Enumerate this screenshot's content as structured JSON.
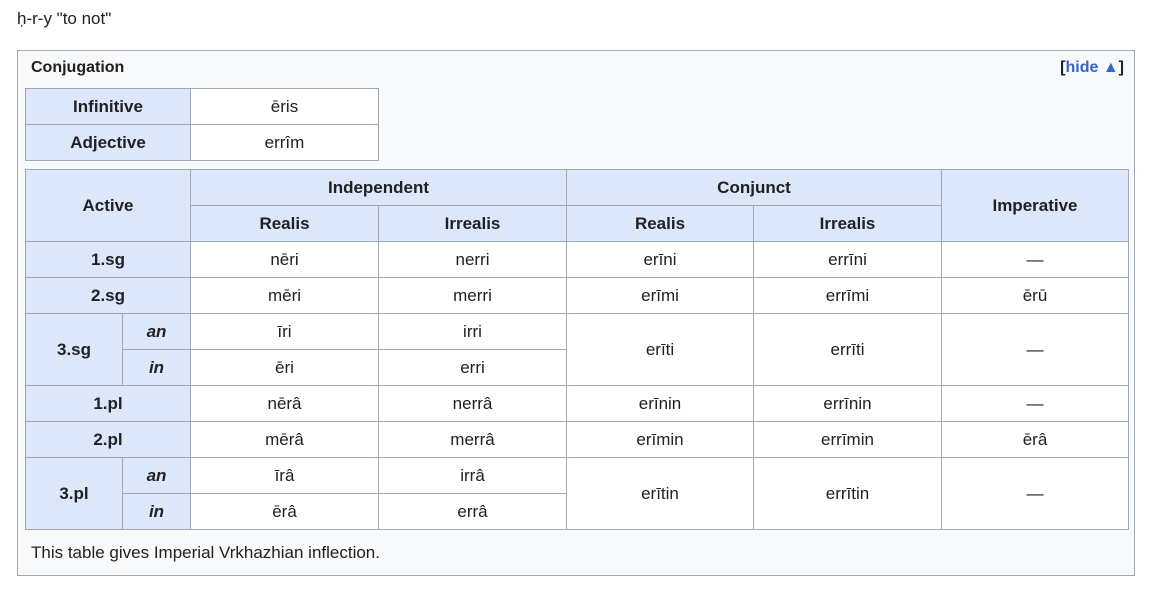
{
  "root": "ḥ-r-y \"to not\"",
  "panel": {
    "title": "Conjugation",
    "toggle_open": "[",
    "toggle_label": "hide ▲",
    "toggle_close": "]"
  },
  "nonfinite": [
    {
      "label": "Infinitive",
      "value": "ēris"
    },
    {
      "label": "Adjective",
      "value": "errîm"
    }
  ],
  "finite": {
    "corner": "Active",
    "groups": [
      "Independent",
      "Conjunct",
      "Imperative"
    ],
    "subheads": [
      "Realis",
      "Irrealis",
      "Realis",
      "Irrealis"
    ],
    "rows": {
      "sg1": {
        "label": "1.sg",
        "cells": [
          "nēri",
          "nerri",
          "erīni",
          "errīni",
          "—"
        ]
      },
      "sg2": {
        "label": "2.sg",
        "cells": [
          "mēri",
          "merri",
          "erīmi",
          "errīmi",
          "ērū"
        ]
      },
      "sg3": {
        "label": "3.sg",
        "an": {
          "label": "an",
          "cells": [
            "īri",
            "irri"
          ]
        },
        "in": {
          "label": "in",
          "cells": [
            "ēri",
            "erri"
          ]
        },
        "shared": [
          "erīti",
          "errīti",
          "—"
        ]
      },
      "pl1": {
        "label": "1.pl",
        "cells": [
          "nērâ",
          "nerrâ",
          "erīnin",
          "errīnin",
          "—"
        ]
      },
      "pl2": {
        "label": "2.pl",
        "cells": [
          "mērâ",
          "merrâ",
          "erīmin",
          "errīmin",
          "ērâ"
        ]
      },
      "pl3": {
        "label": "3.pl",
        "an": {
          "label": "an",
          "cells": [
            "īrâ",
            "irrâ"
          ]
        },
        "in": {
          "label": "in",
          "cells": [
            "ērâ",
            "errâ"
          ]
        },
        "shared": [
          "erītin",
          "errītin",
          "—"
        ]
      }
    }
  },
  "footnote": "This table gives Imperial Vrkhazhian inflection."
}
